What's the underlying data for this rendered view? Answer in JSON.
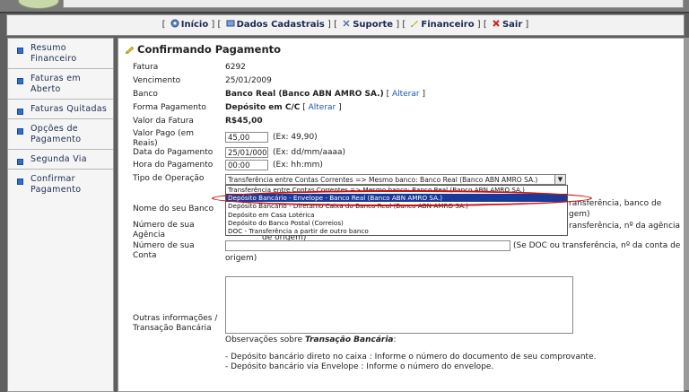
{
  "nav": {
    "items": [
      {
        "label": "Início"
      },
      {
        "label": "Dados Cadastrais"
      },
      {
        "label": "Suporte"
      },
      {
        "label": "Financeiro"
      },
      {
        "label": "Sair"
      }
    ]
  },
  "sidebar": {
    "items": [
      {
        "label": "Resumo Financeiro"
      },
      {
        "label": "Faturas em Aberto"
      },
      {
        "label": "Faturas Quitadas"
      },
      {
        "label": "Opções de Pagamento"
      },
      {
        "label": "Segunda Via"
      },
      {
        "label": "Confirmar Pagamento"
      }
    ]
  },
  "page": {
    "title": "Confirmando Pagamento",
    "fatura_label": "Fatura",
    "fatura": "6292",
    "vencimento_label": "Vencimento",
    "vencimento": "25/01/2009",
    "banco_label": "Banco",
    "banco": "Banco Real (Banco ABN AMRO SA.)",
    "alterar": "Alterar",
    "forma_label": "Forma Pagamento",
    "forma": "Depósito em C/C",
    "valor_fatura_label": "Valor da Fatura",
    "valor_fatura": "R$45,00",
    "valor_pago_label": "Valor Pago (em Reais)",
    "valor_pago": "45,00",
    "valor_pago_hint": "(Ex: 49,90)",
    "data_label": "Data do Pagamento",
    "data": "25/01/000",
    "data_hint": "(Ex: dd/mm/aaaa)",
    "hora_label": "Hora do Pagamento",
    "hora": "00:00",
    "hora_hint": "(Ex: hh:mm)",
    "tipo_label": "Tipo de Operação",
    "tipo_selected": "Transferência entre Contas Correntes => Mesmo banco: Banco Real (Banco ABN AMRO SA.)",
    "tipo_options": [
      "Transferência entre Contas Correntes => Mesmo banco: Banco Real (Banco ABN AMRO SA.)",
      "Depósito Bancário - Envelope - Banco Real (Banco ABN AMRO SA.)",
      "Depósito Bancário - Diretamo Caixa do Banco Real (Banco ABN AMRO SA.)",
      "Depósito em Casa Lotérica",
      "Depósito do Banco Postal (Correios)",
      "DOC - Transferência a partir de outro banco"
    ],
    "nome_banco_label": "Nome do seu Banco",
    "nome_banco_hint": "ransferência, banco de",
    "nome_banco_hint2": "gem)",
    "agencia_label": "Número de sua Agência",
    "agencia_hint": "ransferência, nº da agência",
    "agencia_hint2": "de origem)",
    "conta_label": "Número de sua Conta",
    "conta_hint": "(Se DOC ou transferência, nº da conta de",
    "conta_hint2": "origem)",
    "outras_label": "Outras informações / Transação Bancária",
    "obs_prefix": "Observações sobre",
    "obs_emph": "Transação Bancária",
    "obs_suffix": ":",
    "obs_line1": "- Depósito bancário direto no caixa : Informe o número do documento de seu comprovante.",
    "obs_line2": "- Depósito bancário via Envelope : Informe o número do envelope."
  },
  "colors": {
    "accent": "#1a55bb",
    "selection": "#1a3a9a",
    "highlight": "#d01010"
  }
}
